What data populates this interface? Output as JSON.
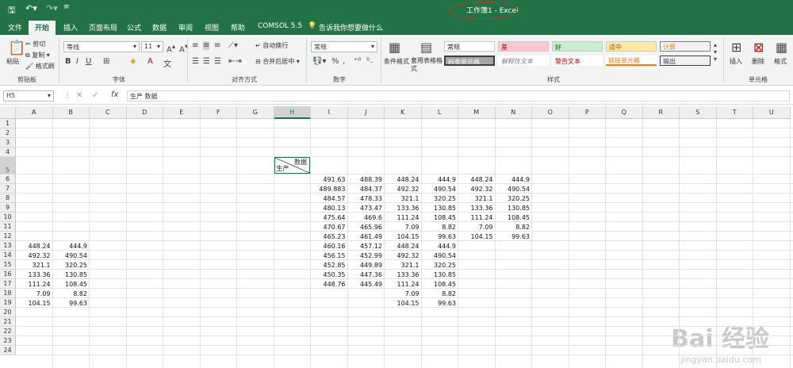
{
  "titlebar": {
    "title": "工作簿1 - Excel",
    "save_icon": "save-icon",
    "undo_icon": "undo-icon",
    "redo_icon": "redo-icon",
    "customize_icon": "customize-quick-access-icon"
  },
  "tabs": [
    "文件",
    "开始",
    "插入",
    "页面布局",
    "公式",
    "数据",
    "审阅",
    "视图",
    "帮助",
    "COMSOL 5.5"
  ],
  "tell_me": "告诉我你想要做什么",
  "ribbon": {
    "clipboard": {
      "paste": "粘贴",
      "cut": "剪切",
      "copy": "复制",
      "format_painter": "格式刷",
      "label": "剪贴板"
    },
    "font": {
      "name": "等线",
      "size": "11",
      "label": "字体"
    },
    "alignment": {
      "wrap": "自动换行",
      "merge": "合并后居中",
      "label": "对齐方式"
    },
    "number": {
      "format": "常规",
      "label": "数字"
    },
    "styles": {
      "conditional": "条件格式",
      "table_format": "套用表格格式",
      "cells": [
        "常规",
        "差",
        "好",
        "适中",
        "计算",
        "检查单元格",
        "解释性文本",
        "警告文本",
        "链接单元格",
        "输出"
      ],
      "label": "样式"
    },
    "cells_group": {
      "insert": "插入",
      "delete": "删除",
      "format": "格式",
      "label": "单元格"
    }
  },
  "formula_bar": {
    "name_box": "H5",
    "content": "生产 数据"
  },
  "columns": [
    "A",
    "B",
    "C",
    "D",
    "E",
    "F",
    "G",
    "H",
    "I",
    "J",
    "K",
    "L",
    "M",
    "N",
    "O",
    "P",
    "Q",
    "R",
    "S",
    "T",
    "U"
  ],
  "rows": [
    "1",
    "2",
    "3",
    "4",
    "5",
    "6",
    "7",
    "8",
    "9",
    "10",
    "11",
    "12",
    "13",
    "14",
    "15",
    "16",
    "17",
    "18",
    "19",
    "20",
    "21",
    "22",
    "23",
    "24"
  ],
  "selected_cell": "H5",
  "header_cell": {
    "top_right": "数据",
    "bottom_left": "生产"
  },
  "sheet_values": {
    "I": {
      "6": "491.63",
      "7": "489.883",
      "8": "484.57",
      "9": "480.13",
      "10": "475.64",
      "11": "470.67",
      "12": "465.23",
      "13": "460.16",
      "14": "456.15",
      "15": "452.85",
      "16": "450.35",
      "17": "448.76"
    },
    "J": {
      "6": "488.39",
      "7": "484.37",
      "8": "478.33",
      "9": "473.47",
      "10": "469.6",
      "11": "465.96",
      "12": "461.49",
      "13": "457.12",
      "14": "452.99",
      "15": "449.89",
      "16": "447.36",
      "17": "445.49"
    },
    "K": {
      "6": "448.24",
      "7": "492.32",
      "8": "321.1",
      "9": "133.36",
      "10": "111.24",
      "11": "7.09",
      "12": "104.15",
      "13": "448.24",
      "14": "492.32",
      "15": "321.1",
      "16": "133.36",
      "17": "111.24",
      "18": "7.09",
      "19": "104.15"
    },
    "L": {
      "6": "444.9",
      "7": "490.54",
      "8": "320.25",
      "9": "130.85",
      "10": "108.45",
      "11": "8.82",
      "12": "99.63",
      "13": "444.9",
      "14": "490.54",
      "15": "320.25",
      "16": "130.85",
      "17": "108.45",
      "18": "8.82",
      "19": "99.63"
    },
    "M": {
      "6": "448.24",
      "7": "492.32",
      "8": "321.1",
      "9": "133.36",
      "10": "111.24",
      "11": "7.09",
      "12": "104.15"
    },
    "N": {
      "6": "444.9",
      "7": "490.54",
      "8": "320.25",
      "9": "130.85",
      "10": "108.45",
      "11": "8.82",
      "12": "99.63"
    },
    "A": {
      "13": "448.24",
      "14": "492.32",
      "15": "321.1",
      "16": "133.36",
      "17": "111.24",
      "18": "7.09",
      "19": "104.15"
    },
    "B": {
      "13": "444.9",
      "14": "490.54",
      "15": "320.25",
      "16": "130.85",
      "17": "108.45",
      "18": "8.82",
      "19": "99.63"
    }
  },
  "watermark": {
    "brand": "Bai 经验",
    "url": "jingyan.baidu.com"
  },
  "colors": {
    "excel_green": "#217346",
    "annotation_red": "#c0392b"
  }
}
